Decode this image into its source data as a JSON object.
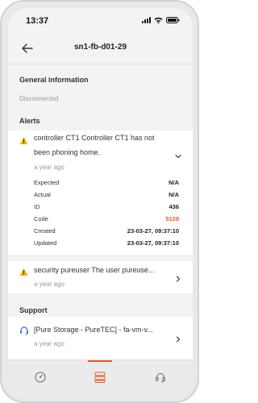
{
  "status_bar": {
    "time": "13:37"
  },
  "header": {
    "title": "sn1-fb-d01-29"
  },
  "general": {
    "heading": "General information",
    "status": "Disconnected"
  },
  "alerts": {
    "heading": "Alerts",
    "items": [
      {
        "line1": "controller CT1 Controller CT1 has not",
        "line2": "been phoning home.",
        "age": "a year ago",
        "details": [
          {
            "key": "Expected",
            "value": "N/A"
          },
          {
            "key": "Actual",
            "value": "N/A"
          },
          {
            "key": "ID",
            "value": "436"
          },
          {
            "key": "Code",
            "value": "5129"
          },
          {
            "key": "Created",
            "value": "23-03-27, 09:37:10"
          },
          {
            "key": "Updated",
            "value": "23-03-27, 09:37:10"
          }
        ]
      },
      {
        "line1": "security pureuser The user pureuse...",
        "age": "a year ago"
      }
    ]
  },
  "support": {
    "heading": "Support",
    "items": [
      {
        "text": "[Pure Storage - PureTEC] - fa-vm-v...",
        "age": "a year ago"
      }
    ]
  },
  "colors": {
    "accent": "#f05a28",
    "warning": "#f2b705"
  },
  "tabs": [
    {
      "icon": "dashboard-icon"
    },
    {
      "icon": "storage-icon",
      "active": true
    },
    {
      "icon": "support-headset-icon"
    }
  ]
}
